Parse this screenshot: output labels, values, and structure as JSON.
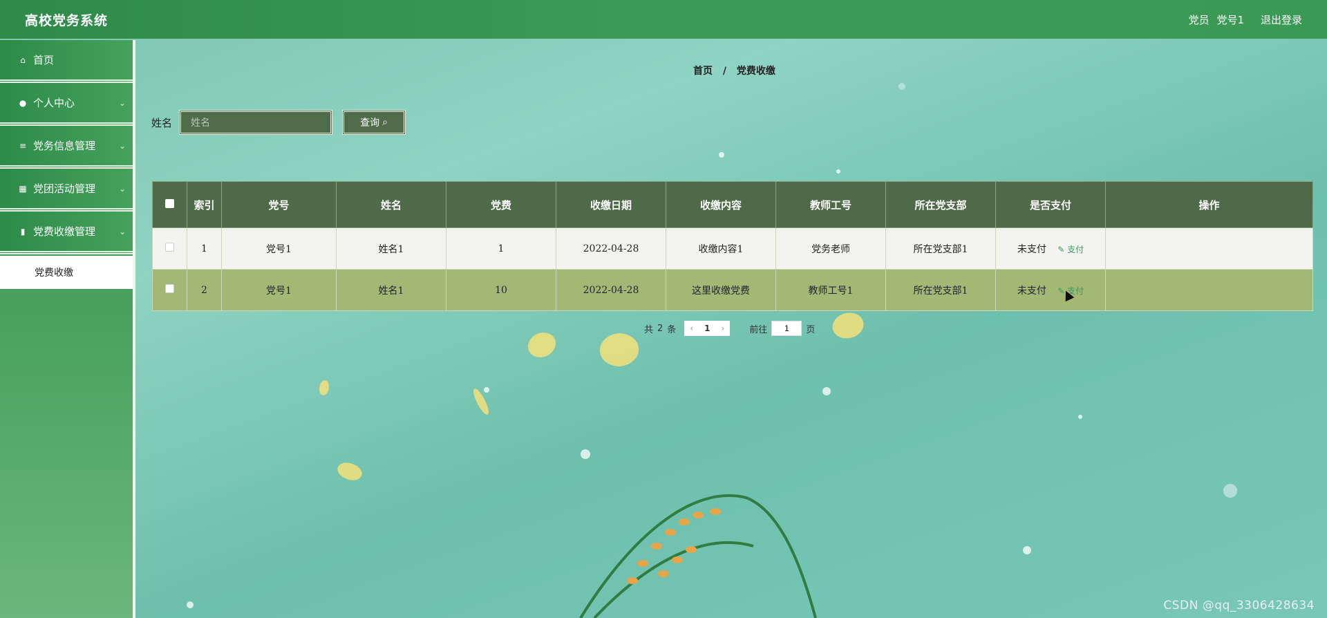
{
  "header": {
    "title": "高校党务系统",
    "role": "党员",
    "username": "党号1",
    "logout": "退出登录"
  },
  "sidebar": {
    "items": [
      {
        "label": "首页",
        "icon": "home-icon"
      },
      {
        "label": "个人中心",
        "icon": "user-icon"
      },
      {
        "label": "党务信息管理",
        "icon": "sliders-icon"
      },
      {
        "label": "党团活动管理",
        "icon": "grid-icon"
      },
      {
        "label": "党费收缴管理",
        "icon": "bar-chart-icon"
      }
    ],
    "submenu_label": "党费收缴"
  },
  "breadcrumb": {
    "home": "首页",
    "sep": "/",
    "current": "党费收缴"
  },
  "search": {
    "label": "姓名",
    "placeholder": "姓名",
    "button": "查询"
  },
  "table": {
    "headers": [
      "索引",
      "党号",
      "姓名",
      "党费",
      "收缴日期",
      "收缴内容",
      "教师工号",
      "所在党支部",
      "是否支付",
      "操作"
    ],
    "rows": [
      {
        "index": "1",
        "party_no": "党号1",
        "name": "姓名1",
        "fee": "1",
        "date": "2022-04-28",
        "content": "收缴内容1",
        "teacher_no": "党务老师",
        "branch": "所在党支部1",
        "paid": "未支付",
        "pay_link": "支付"
      },
      {
        "index": "2",
        "party_no": "党号1",
        "name": "姓名1",
        "fee": "10",
        "date": "2022-04-28",
        "content": "这里收缴党费",
        "teacher_no": "教师工号1",
        "branch": "所在党支部1",
        "paid": "未支付",
        "pay_link": "支付"
      }
    ]
  },
  "pagination": {
    "total_prefix": "共",
    "total": "2",
    "total_suffix": "条",
    "current_page": "1",
    "goto_label": "前往",
    "goto_value": "1",
    "page_suffix": "页"
  },
  "watermark": "CSDN @qq_3306428634"
}
